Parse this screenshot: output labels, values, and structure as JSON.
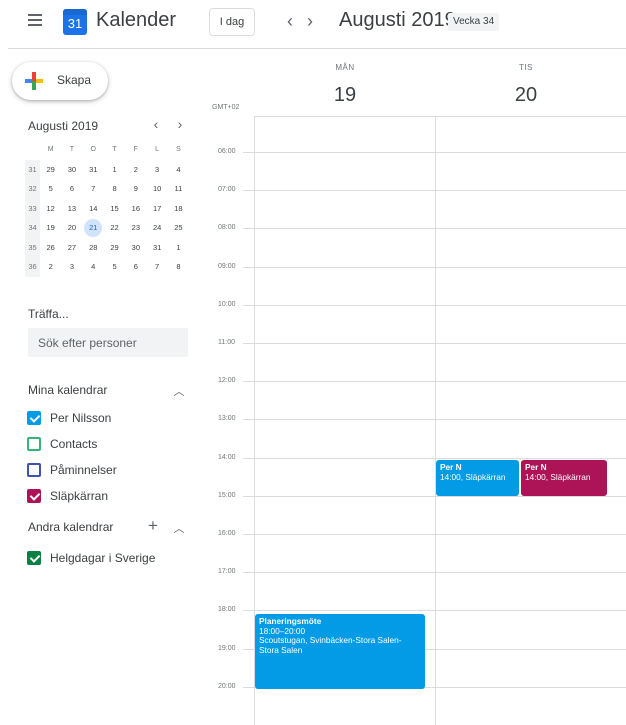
{
  "header": {
    "app_title": "Kalender",
    "logo_day": "31",
    "today_button": "I dag",
    "prev_icon": "chevron-left-icon",
    "next_icon": "chevron-right-icon",
    "month_title": "Augusti 2019",
    "week_badge": "Vecka 34"
  },
  "sidebar": {
    "create_label": "Skapa",
    "mini_calendar": {
      "title": "Augusti 2019",
      "weekday_headers": [
        "M",
        "T",
        "O",
        "T",
        "F",
        "L",
        "S"
      ],
      "weeks": [
        {
          "week": "31",
          "days": [
            "29",
            "30",
            "31",
            "1",
            "2",
            "3",
            "4"
          ]
        },
        {
          "week": "32",
          "days": [
            "5",
            "6",
            "7",
            "8",
            "9",
            "10",
            "11"
          ]
        },
        {
          "week": "33",
          "days": [
            "12",
            "13",
            "14",
            "15",
            "16",
            "17",
            "18"
          ]
        },
        {
          "week": "34",
          "days": [
            "19",
            "20",
            "21",
            "22",
            "23",
            "24",
            "25"
          ]
        },
        {
          "week": "35",
          "days": [
            "26",
            "27",
            "28",
            "29",
            "30",
            "31",
            "1"
          ]
        },
        {
          "week": "36",
          "days": [
            "2",
            "3",
            "4",
            "5",
            "6",
            "7",
            "8"
          ]
        }
      ],
      "selected_day": "21"
    },
    "meet_title": "Träffa...",
    "people_search_placeholder": "Sök efter personer",
    "my_calendars": {
      "title": "Mina kalendrar",
      "items": [
        {
          "label": "Per Nilsson",
          "color": "#039be5",
          "checked": true
        },
        {
          "label": "Contacts",
          "color": "#33b679",
          "checked": false
        },
        {
          "label": "Påminnelser",
          "color": "#3f51b5",
          "checked": false
        },
        {
          "label": "Släpkärran",
          "color": "#ad1457",
          "checked": true
        }
      ]
    },
    "other_calendars": {
      "title": "Andra kalendrar",
      "items": [
        {
          "label": "Helgdagar i Sverige",
          "color": "#0b8043",
          "checked": true
        }
      ]
    }
  },
  "week_view": {
    "timezone": "GMT+02",
    "days": [
      {
        "dow": "MÅN",
        "date": "19"
      },
      {
        "dow": "TIS",
        "date": "20"
      }
    ],
    "hours": [
      "06:00",
      "07:00",
      "08:00",
      "09:00",
      "10:00",
      "11:00",
      "12:00",
      "13:00",
      "14:00",
      "15:00",
      "16:00",
      "17:00",
      "18:00",
      "19:00",
      "20:00"
    ],
    "events": [
      {
        "title": "Per N",
        "detail": "14:00, Släpkärran",
        "location": "",
        "color": "#039be5"
      },
      {
        "title": "Per N",
        "detail": "14:00, Släpkärran",
        "location": "",
        "color": "#ad1457"
      },
      {
        "title": "Planeringsmöte",
        "detail": "18:00–20:00",
        "location": "Scoutstugan, Svinbäcken-Stora Salen-Stora Salen",
        "color": "#039be5"
      }
    ]
  }
}
